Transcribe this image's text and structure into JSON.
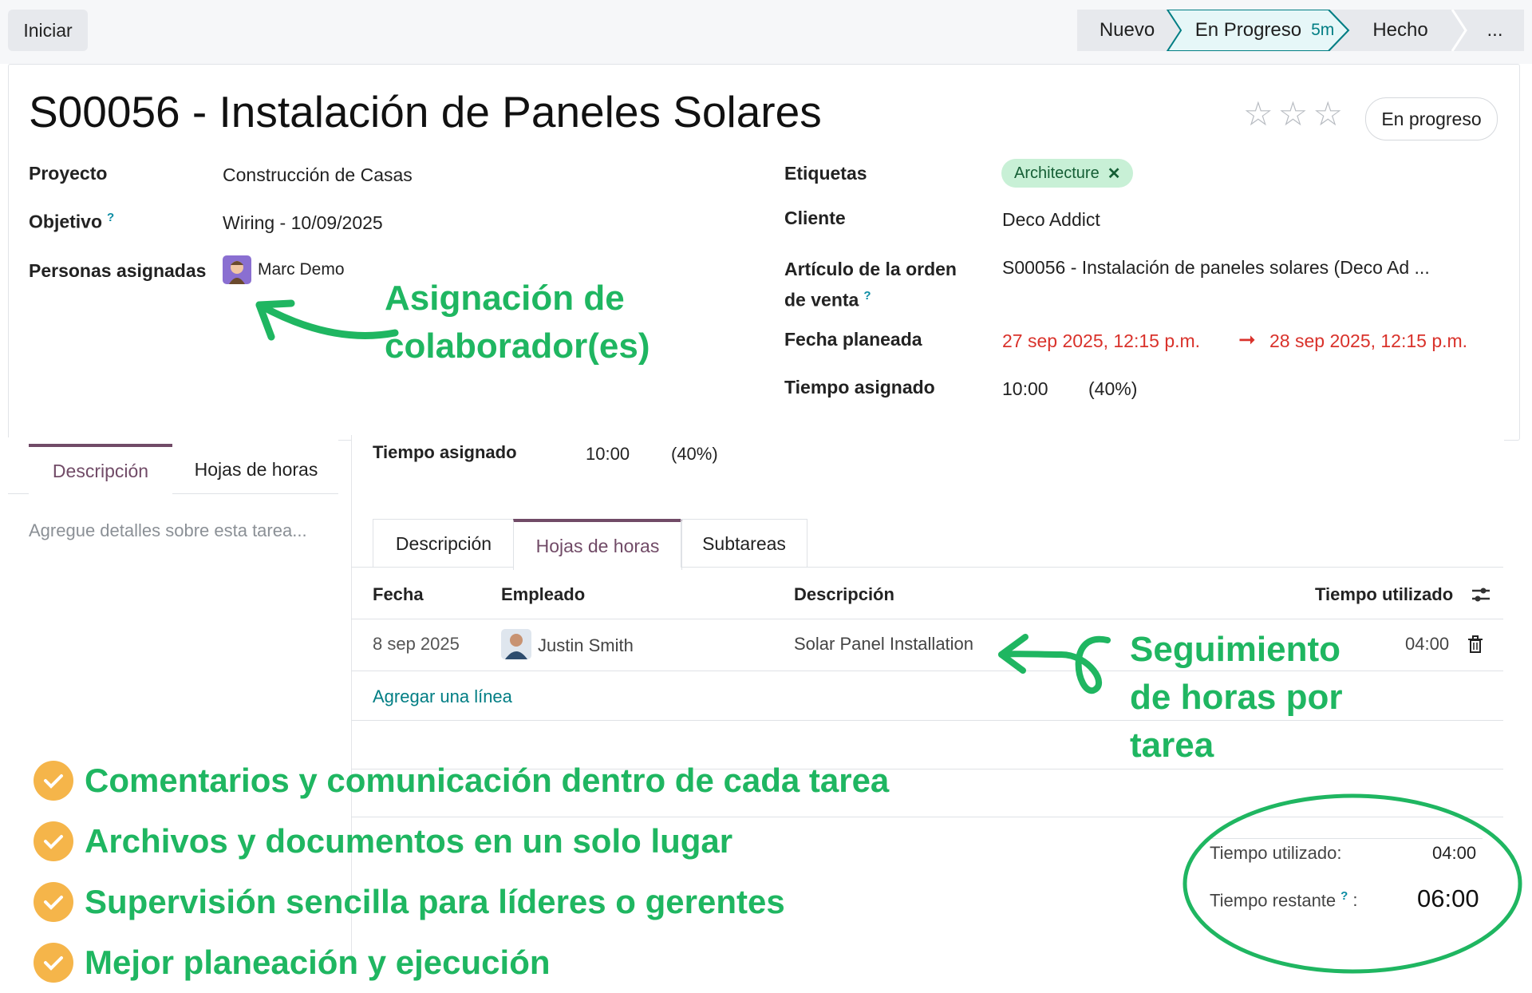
{
  "topbar": {
    "start_label": "Iniciar",
    "stages": [
      {
        "label": "Nuevo"
      },
      {
        "label": "En Progreso",
        "badge": "5m",
        "active": true
      },
      {
        "label": "Hecho"
      },
      {
        "label": "..."
      }
    ]
  },
  "task": {
    "title": "S00056 - Instalación de Paneles Solares",
    "status": "En progreso",
    "stars": 3,
    "fields_left": [
      {
        "label": "Proyecto",
        "value": "Construcción de Casas"
      },
      {
        "label": "Objetivo",
        "help": "?",
        "value": "Wiring - 10/09/2025"
      },
      {
        "label": "Personas asignadas",
        "value": "Marc Demo"
      }
    ],
    "fields_right": {
      "tags_label": "Etiquetas",
      "tag": "Architecture",
      "tag_remove": "✕",
      "client_label": "Cliente",
      "client": "Deco Addict",
      "sale_line_label_1": "Artículo de la orden",
      "sale_line_label_2": "de venta",
      "sale_line_help": "?",
      "sale_line": "S00056 - Instalación de paneles solares (Deco Ad ...",
      "planned_label": "Fecha planeada",
      "planned_start": "27 sep 2025, 12:15 p.m.",
      "planned_arrow": "➞",
      "planned_end": "28 sep 2025, 12:15 p.m.",
      "allocated_label": "Tiempo asignado",
      "allocated_time": "10:00",
      "allocated_pct": "(40%)"
    }
  },
  "left_panel": {
    "tabs": [
      "Descripción",
      "Hojas de horas"
    ],
    "placeholder": "Agregue detalles sobre esta tarea..."
  },
  "right_panel": {
    "allocated_label": "Tiempo asignado",
    "allocated_time": "10:00",
    "allocated_pct": "(40%)",
    "tabs": [
      "Descripción",
      "Hojas de horas",
      "Subtareas"
    ],
    "columns": [
      "Fecha",
      "Empleado",
      "Descripción",
      "Tiempo utilizado"
    ],
    "rows": [
      {
        "date": "8 sep 2025",
        "employee": "Justin Smith",
        "description": "Solar Panel Installation",
        "time": "04:00"
      }
    ],
    "add_line": "Agregar una línea",
    "totals": {
      "spent_label": "Tiempo utilizado:",
      "spent": "04:00",
      "remaining_label": "Tiempo restante",
      "remaining_help": "?",
      "remaining_colon": ":",
      "remaining": "06:00"
    }
  },
  "annotations": {
    "assign_line1": "Asignación de",
    "assign_line2": "colaborador(es)",
    "tracking_line1": "Seguimiento",
    "tracking_line2": "de horas por",
    "tracking_line3": "tarea"
  },
  "features": [
    "Comentarios y comunicación dentro de cada tarea",
    "Archivos y documentos en un solo lugar",
    "Supervisión sencilla para líderes o gerentes",
    "Mejor planeación y ejecución"
  ],
  "colors": {
    "accent_green": "#1fb661",
    "check_orange": "#f5b54a",
    "tab_active": "#714b67",
    "date_red": "#d9322b",
    "link_teal": "#017e84"
  }
}
